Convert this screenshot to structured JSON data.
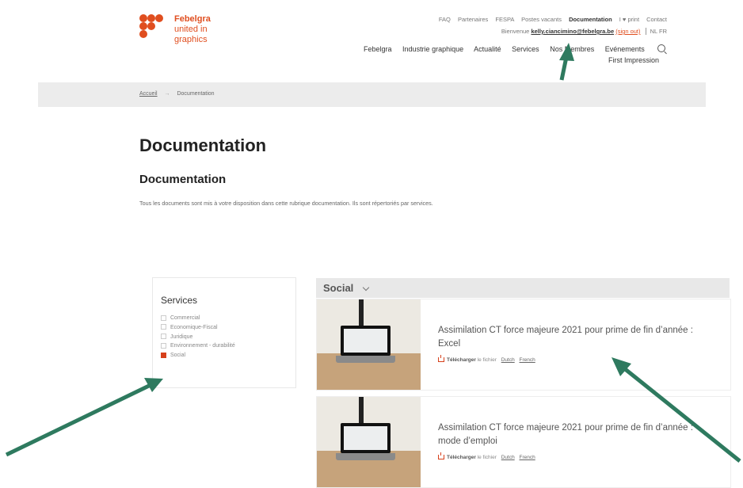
{
  "logo": {
    "line1": "Febelgra",
    "line2": "united in",
    "line3": "graphics"
  },
  "util_nav": [
    "FAQ",
    "Partenaires",
    "FESPA",
    "Postes vacants",
    "Documentation",
    "I ♥ print",
    "Contact"
  ],
  "welcome": {
    "prefix": "Bienvenue",
    "email": "kelly.ciancimino@febelgra.be",
    "signout": "(sign out)",
    "langs": "NL  FR"
  },
  "main_nav": [
    "Febelgra",
    "Industrie graphique",
    "Actualité",
    "Services",
    "Nos Membres",
    "Evénements"
  ],
  "main_nav_sub": "First Impression",
  "breadcrumb": {
    "home": "Accueil",
    "sep": "→",
    "current": "Documentation"
  },
  "page_title": "Documentation",
  "section_title": "Documentation",
  "intro": "Tous les documents sont mis à votre disposition dans cette rubrique documentation. Ils sont répertoriés par services.",
  "services": {
    "title": "Services",
    "items": [
      {
        "label": "Commercial",
        "checked": false
      },
      {
        "label": "Economique-Fiscal",
        "checked": false
      },
      {
        "label": "Juridique",
        "checked": false
      },
      {
        "label": "Environnement - durabilité",
        "checked": false
      },
      {
        "label": "Social",
        "checked": true
      }
    ]
  },
  "social": {
    "label": "Social"
  },
  "cards": [
    {
      "title": "Assimilation CT force majeure 2021 pour prime de fin d’année : Excel",
      "download_label": "Télécharger",
      "download_suffix": "le fichier",
      "link1": "Dutch",
      "link2": "French"
    },
    {
      "title": "Assimilation CT force majeure 2021 pour prime de fin d’année : mode d’emploi",
      "download_label": "Télécharger",
      "download_suffix": "le fichier",
      "link1": "Dutch",
      "link2": "French"
    }
  ],
  "colors": {
    "accent": "#e04e1f",
    "arrow": "#2e7a5f",
    "panel": "#ececec"
  }
}
